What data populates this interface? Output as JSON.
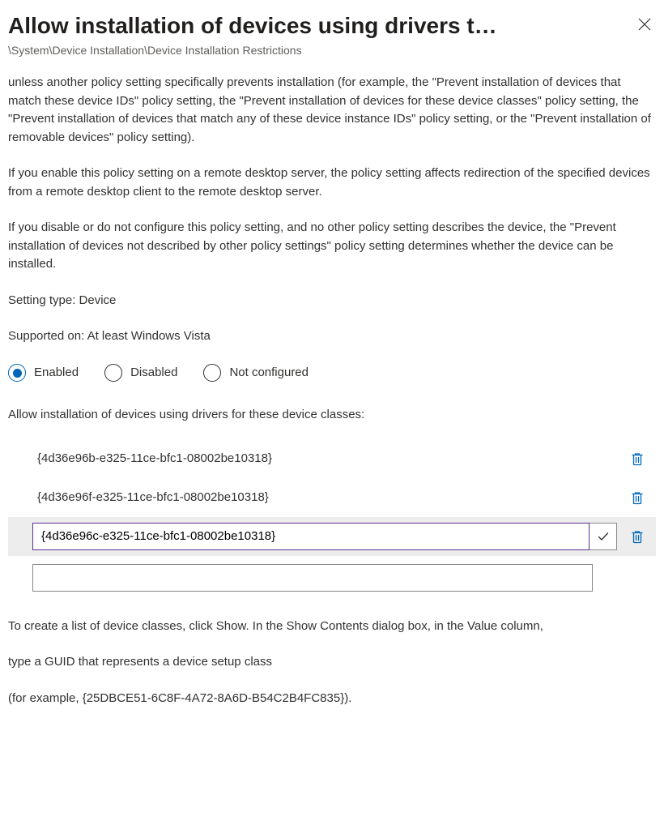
{
  "header": {
    "title": "Allow installation of devices using drivers t…"
  },
  "breadcrumb": "\\System\\Device Installation\\Device Installation Restrictions",
  "body": {
    "para1": "unless another policy setting specifically prevents installation (for example, the \"Prevent installation of devices that match these device IDs\" policy setting, the \"Prevent installation of devices for these device classes\" policy setting, the \"Prevent installation of devices that match any of these device instance IDs\" policy setting, or the \"Prevent installation of removable devices\" policy setting).",
    "para2": "If you enable this policy setting on a remote desktop server, the policy setting affects redirection of the specified devices from a remote desktop client to the remote desktop server.",
    "para3": "If you disable or do not configure this policy setting, and no other policy setting describes the device, the \"Prevent installation of devices not described by other policy settings\" policy setting determines whether the device can be installed."
  },
  "meta": {
    "settingType": "Setting type: Device",
    "supportedOn": "Supported on: At least Windows Vista"
  },
  "radios": {
    "enabled": "Enabled",
    "disabled": "Disabled",
    "notConfigured": "Not configured",
    "selected": "enabled"
  },
  "listSection": {
    "label": "Allow installation of devices using drivers for these device classes:",
    "items": [
      "{4d36e96b-e325-11ce-bfc1-08002be10318}",
      "{4d36e96f-e325-11ce-bfc1-08002be10318}"
    ],
    "editingValue": "{4d36e96c-e325-11ce-bfc1-08002be10318}",
    "emptyValue": ""
  },
  "footer": {
    "p1": "To create a list of device classes, click Show. In the Show Contents dialog box, in the Value column,",
    "p2": "type a GUID that represents a device setup class",
    "p3": "(for example, {25DBCE51-6C8F-4A72-8A6D-B54C2B4FC835})."
  },
  "colors": {
    "accent": "#0067b8",
    "editBorder": "#5b2e91"
  }
}
